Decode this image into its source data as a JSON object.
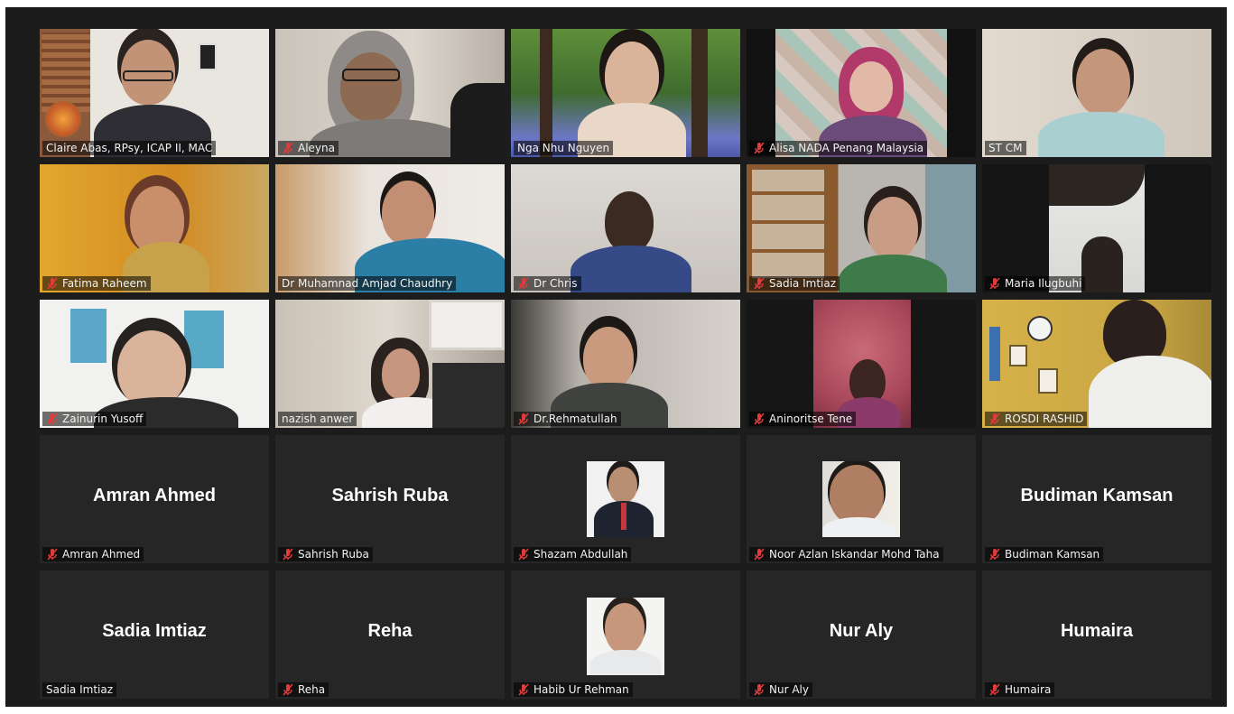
{
  "meeting": {
    "participants": [
      {
        "name": "Claire Abas, RPsy, ICAP II, MAC",
        "muted": false,
        "video": true
      },
      {
        "name": "Aleyna",
        "muted": true,
        "video": true
      },
      {
        "name": "Nga Nhu Nguyen",
        "muted": false,
        "video": true
      },
      {
        "name": "Alisa NADA Penang Malaysia",
        "muted": true,
        "video": true
      },
      {
        "name": "ST CM",
        "muted": false,
        "video": true
      },
      {
        "name": "Fatima Raheem",
        "muted": true,
        "video": true
      },
      {
        "name": "Dr Muhamnad Amjad Chaudhry",
        "muted": false,
        "video": true
      },
      {
        "name": "Dr Chris",
        "muted": true,
        "video": true
      },
      {
        "name": "Sadia Imtiaz",
        "muted": true,
        "video": true
      },
      {
        "name": "Maria Ilugbuhi",
        "muted": true,
        "video": true
      },
      {
        "name": "Zainurin Yusoff",
        "muted": true,
        "video": true
      },
      {
        "name": "nazish anwer",
        "muted": false,
        "video": true
      },
      {
        "name": "Dr.Rehmatullah",
        "muted": true,
        "video": true
      },
      {
        "name": "Aninoritse Tene",
        "muted": true,
        "video": true
      },
      {
        "name": "ROSDI RASHID",
        "muted": true,
        "video": true
      },
      {
        "name": "Amran Ahmed",
        "muted": true,
        "video": false,
        "display": "Amran Ahmed"
      },
      {
        "name": "Sahrish Ruba",
        "muted": true,
        "video": false,
        "display": "Sahrish Ruba"
      },
      {
        "name": "Shazam Abdullah",
        "muted": true,
        "video": false,
        "avatar": true
      },
      {
        "name": "Noor Azlan Iskandar Mohd Taha",
        "muted": true,
        "video": false,
        "avatar": true
      },
      {
        "name": "Budiman Kamsan",
        "muted": true,
        "video": false,
        "display": "Budiman Kamsan"
      },
      {
        "name": "Sadia Imtiaz",
        "muted": false,
        "video": false,
        "display": "Sadia Imtiaz"
      },
      {
        "name": "Reha",
        "muted": true,
        "video": false,
        "display": "Reha"
      },
      {
        "name": "Habib Ur Rehman",
        "muted": true,
        "video": false,
        "avatar": true
      },
      {
        "name": "Nur Aly",
        "muted": true,
        "video": false,
        "display": "Nur Aly"
      },
      {
        "name": "Humaira",
        "muted": true,
        "video": false,
        "display": "Humaira"
      }
    ]
  },
  "icons": {
    "muted": "mic-muted-icon"
  },
  "colors": {
    "active_speaker": "#d7ea6a",
    "muted_icon": "#e03b3b",
    "background": "#1c1c1c",
    "tile": "#262626"
  }
}
